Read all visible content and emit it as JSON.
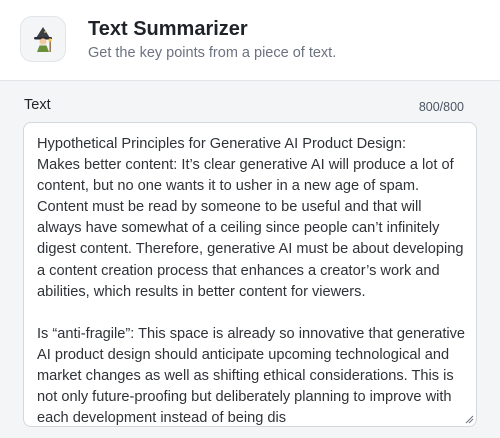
{
  "header": {
    "icon": "wizard-icon",
    "title": "Text Summarizer",
    "subtitle": "Get the key points from a piece of text."
  },
  "field": {
    "label": "Text",
    "counter": "800/800",
    "value": "Hypothetical Principles for Generative AI Product Design:\nMakes better content: It’s clear generative AI will produce a lot of content, but no one wants it to usher in a new age of spam. Content must be read by someone to be useful and that will always have somewhat of a ceiling since people can’t infinitely digest content. Therefore, generative AI must be about developing a content creation process that enhances a creator’s work and abilities, which results in better content for viewers.\n\nIs “anti-fragile”: This space is already so innovative that generative AI product design should anticipate upcoming technological and market changes as well as shifting ethical considerations. This is not only future-proofing but deliberately planning to improve with each development instead of being dis"
  }
}
